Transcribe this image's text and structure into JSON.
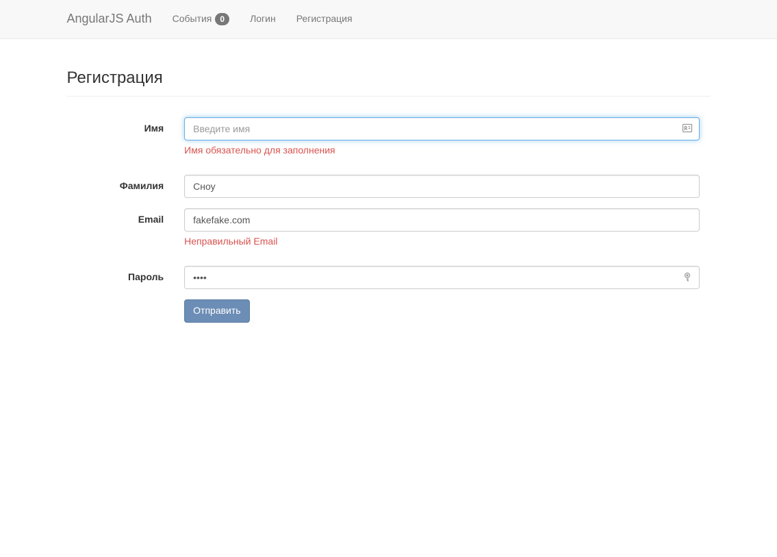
{
  "navbar": {
    "brand": "AngularJS Auth",
    "links": {
      "events": "События",
      "events_badge": "0",
      "login": "Логин",
      "register": "Регистрация"
    }
  },
  "page": {
    "title": "Регистрация"
  },
  "form": {
    "name": {
      "label": "Имя",
      "placeholder": "Введите имя",
      "value": "",
      "error": "Имя обязательно для заполнения"
    },
    "surname": {
      "label": "Фамилия",
      "value": "Сноу"
    },
    "email": {
      "label": "Email",
      "value": "fakefake.com",
      "error": "Неправильный Email"
    },
    "password": {
      "label": "Пароль",
      "value": "••••"
    },
    "submit": "Отправить"
  }
}
